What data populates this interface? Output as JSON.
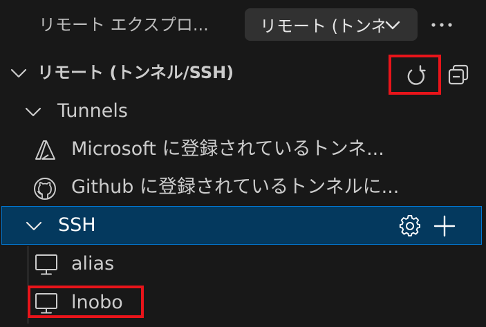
{
  "titlebar": {
    "title": "リモート エクスプロ...",
    "view_select": "リモート (トンネル/SSH)",
    "more_icon": "ellipsis-icon"
  },
  "section": {
    "title": "リモート (トンネル/SSH)",
    "refresh_icon": "refresh-icon",
    "collapse_icon": "collapse-all-icon"
  },
  "tree": {
    "tunnels": {
      "label": "Tunnels",
      "items": [
        {
          "label": "Microsoft に登録されているトンネ...",
          "icon": "azure-icon"
        },
        {
          "label": "Github に登録されているトンネルに...",
          "icon": "github-icon"
        }
      ]
    },
    "ssh": {
      "label": "SSH",
      "settings_icon": "gear-icon",
      "add_icon": "plus-icon",
      "hosts": [
        {
          "label": "alias",
          "icon": "monitor-icon"
        },
        {
          "label": "lnobo",
          "icon": "monitor-icon"
        }
      ]
    }
  },
  "colors": {
    "background": "#181818",
    "selection": "#04395e",
    "selection_border": "#0078d4",
    "highlight": "#e8141a"
  }
}
